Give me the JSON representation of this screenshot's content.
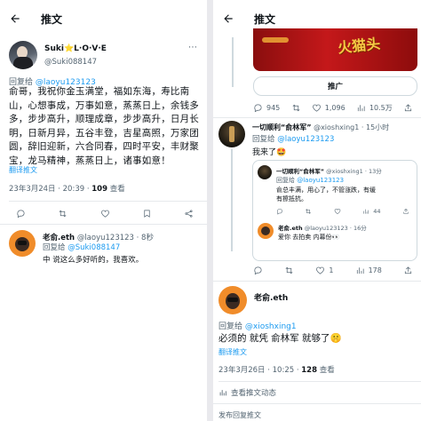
{
  "left": {
    "title": "推文",
    "tweet": {
      "name": "Suki⭐L·O·V·E",
      "handle": "@Suki088147",
      "reply_prefix": "回复给",
      "reply_to": "@laoyu123123",
      "text": "俞哥，我祝你金玉满堂，福如东海，寿比南山，心想事成，万事如意，蒸蒸日上，余钱多多，步步高升，顺理成章，步步高升，日月长明，日新月异，五谷丰登，吉星高照，万家团圆，辞旧迎新，六合同春，四时平安，丰财聚宝，龙马精神，蒸蒸日上，诸事如意！",
      "translate": "翻译推文",
      "date": "23年3月24日 · 20:39 · ",
      "views": "109",
      "views_label": " 查看"
    },
    "reply": {
      "name": "老俞.eth",
      "handle": "@laoyu123123",
      "time": "· 8秒",
      "reply_prefix": "回复给",
      "reply_to": "@Suki088147",
      "text": "中 说这么多好听的，我喜欢。"
    }
  },
  "right": {
    "title": "推文",
    "banner_text": "火猫头",
    "promo_button": "推广",
    "stats1": {
      "replies": "945",
      "retweets": "",
      "likes": "1,096",
      "views": "10.5万"
    },
    "tweet": {
      "name": "一切顺利“俞林军”",
      "handle": "@xioshxing1",
      "time": "· 15小时",
      "reply_prefix": "回复给",
      "reply_to": "@laoyu123123",
      "text": "我来了🤩"
    },
    "quoted1": {
      "name": "一切顺利“俞林军”",
      "handle": "@xioshxing1",
      "time": "· 13分",
      "reply_prefix": "回复给",
      "reply_to": "@laoyu123123",
      "text": "俞总丰满，用心了，不管涨跌，有缓有擦抵抗。",
      "likes": "44"
    },
    "quoted2": {
      "name": "老俞.eth",
      "handle": "@laoyu123123",
      "time": "· 16分",
      "text": "爱你 去拍卖 内幕份👀"
    },
    "stats2": {
      "replies": "",
      "retweets": "",
      "likes": "1",
      "views": "178"
    },
    "reply": {
      "name": "老俞.eth",
      "reply_prefix": "回复给",
      "reply_to": "@xioshxing1",
      "text": "必须的 就凭 俞林军 就够了🤫",
      "translate": "翻译推文",
      "date": "23年3月26日 · 10:25 · ",
      "views": "128",
      "views_label": " 查看"
    },
    "activity": "查看推文动态",
    "bottom_text": "发布回复推文"
  }
}
